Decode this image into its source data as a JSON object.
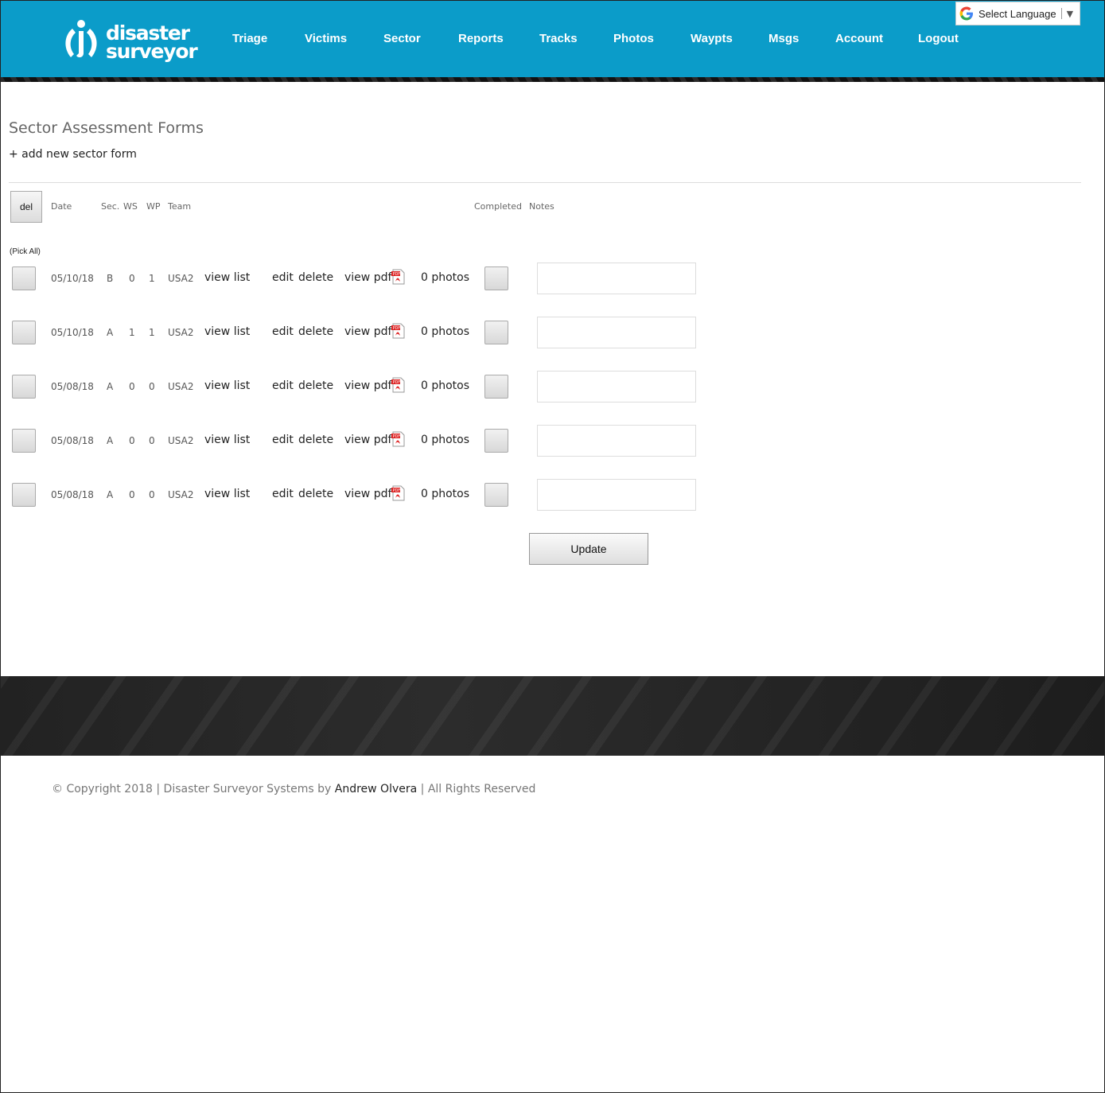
{
  "header": {
    "logo_line1": "disaster",
    "logo_line2": "surveyor",
    "nav": [
      "Triage",
      "Victims",
      "Sector",
      "Reports",
      "Tracks",
      "Photos",
      "Waypts",
      "Msgs",
      "Account",
      "Logout"
    ],
    "language": {
      "label": "Select Language",
      "arrow": "▼"
    }
  },
  "page": {
    "title": "Sector Assessment Forms",
    "add_link": "+ add new sector form",
    "del_button": "del",
    "pick_all": "(Pick All)",
    "columns": {
      "date": "Date",
      "sec": "Sec.",
      "ws": "WS",
      "wp": "WP",
      "team": "Team",
      "completed": "Completed",
      "notes": "Notes"
    },
    "rows": [
      {
        "date": "05/10/18",
        "sec": "B",
        "ws": "0",
        "wp": "1",
        "team": "USA2",
        "view_list": "view list",
        "edit": "edit",
        "delete": "delete",
        "view_pdf": "view pdf",
        "photos": "0 photos",
        "notes": ""
      },
      {
        "date": "05/10/18",
        "sec": "A",
        "ws": "1",
        "wp": "1",
        "team": "USA2",
        "view_list": "view list",
        "edit": "edit",
        "delete": "delete",
        "view_pdf": "view pdf",
        "photos": "0 photos",
        "notes": ""
      },
      {
        "date": "05/08/18",
        "sec": "A",
        "ws": "0",
        "wp": "0",
        "team": "USA2",
        "view_list": "view list",
        "edit": "edit",
        "delete": "delete",
        "view_pdf": "view pdf",
        "photos": "0 photos",
        "notes": ""
      },
      {
        "date": "05/08/18",
        "sec": "A",
        "ws": "0",
        "wp": "0",
        "team": "USA2",
        "view_list": "view list",
        "edit": "edit",
        "delete": "delete",
        "view_pdf": "view pdf",
        "photos": "0 photos",
        "notes": ""
      },
      {
        "date": "05/08/18",
        "sec": "A",
        "ws": "0",
        "wp": "0",
        "team": "USA2",
        "view_list": "view list",
        "edit": "edit",
        "delete": "delete",
        "view_pdf": "view pdf",
        "photos": "0 photos",
        "notes": ""
      }
    ],
    "update_button": "Update"
  },
  "footer": {
    "copyright_prefix": "© Copyright 2018 | Disaster Surveyor Systems by ",
    "author": "Andrew Olvera",
    "copyright_suffix": " | All Rights Reserved"
  },
  "colors": {
    "header_bg": "#0b9cc9",
    "footer_band": "#222222"
  },
  "icons": {
    "pdf": "pdf-icon",
    "google": "google-icon",
    "logo": "logo-icon"
  }
}
